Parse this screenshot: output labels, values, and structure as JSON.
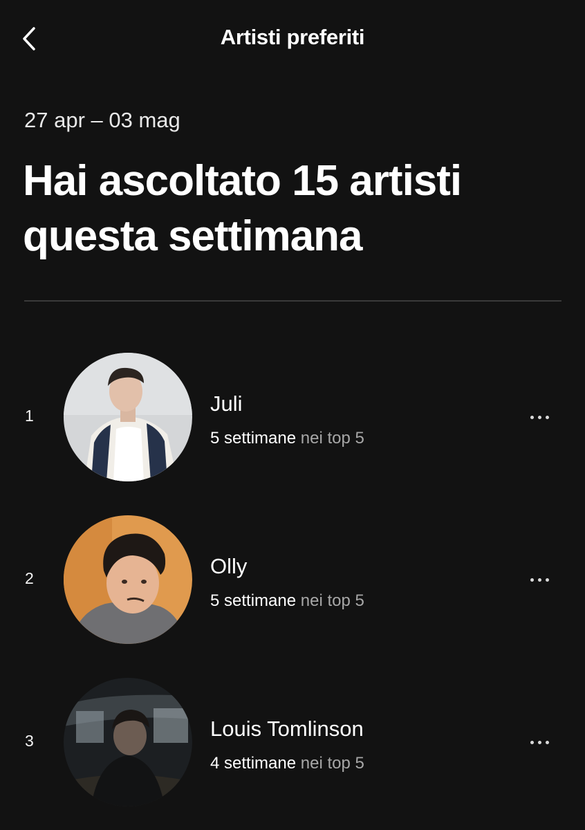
{
  "header": {
    "back_icon": "chevron-left-icon",
    "title": "Artisti preferiti"
  },
  "summary": {
    "date_range": "27 apr – 03 mag",
    "headline": "Hai ascoltato 15 artisti questa settimana"
  },
  "artists": [
    {
      "rank": "1",
      "name": "Juli",
      "weeks": "5 settimane",
      "rest": " nei top 5",
      "more_icon": "more-horizontal-icon"
    },
    {
      "rank": "2",
      "name": "Olly",
      "weeks": "5 settimane",
      "rest": " nei top 5",
      "more_icon": "more-horizontal-icon"
    },
    {
      "rank": "3",
      "name": "Louis Tomlinson",
      "weeks": "4 settimane",
      "rest": " nei top 5",
      "more_icon": "more-horizontal-icon"
    }
  ],
  "colors": {
    "background": "#121212",
    "text_primary": "#ffffff",
    "text_secondary": "#a7a7a7",
    "divider": "#3a3a3a"
  }
}
